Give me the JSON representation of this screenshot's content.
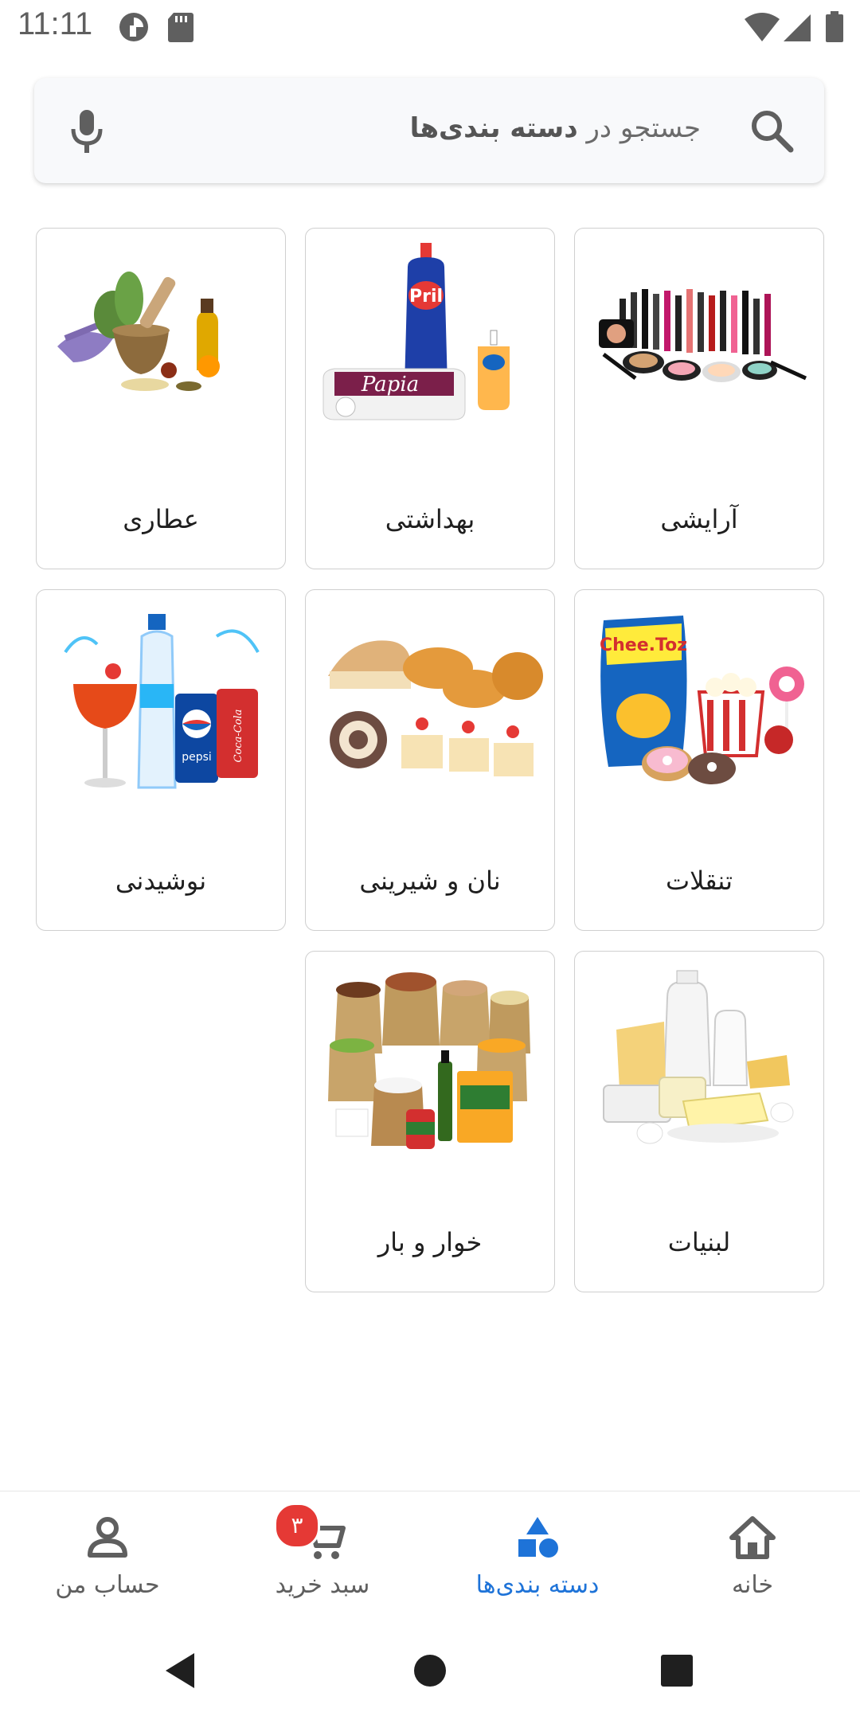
{
  "status_bar": {
    "time": "11:11",
    "icons": [
      "pinwheel-icon",
      "sd-card-icon",
      "wifi-icon",
      "signal-icon",
      "battery-icon"
    ]
  },
  "search": {
    "placeholder_prefix": "جستجو در",
    "placeholder_bold": "دسته بندی‌ها",
    "icons": [
      "search-icon",
      "mic-icon"
    ]
  },
  "categories": [
    {
      "label": "آرایشی",
      "icon": "cosmetics-image"
    },
    {
      "label": "بهداشتی",
      "icon": "hygiene-image"
    },
    {
      "label": "عطاری",
      "icon": "herbs-image"
    },
    {
      "label": "تنقلات",
      "icon": "snacks-image"
    },
    {
      "label": "نان و شیرینی",
      "icon": "bread-pastry-image"
    },
    {
      "label": "نوشیدنی",
      "icon": "drinks-image"
    },
    {
      "label": "لبنیات",
      "icon": "dairy-image"
    },
    {
      "label": "خوار و بار",
      "icon": "groceries-image"
    }
  ],
  "bottom_nav": {
    "home": "خانه",
    "categories": "دسته بندی‌ها",
    "cart": "سبد خرید",
    "cart_badge": "۳",
    "account": "حساب من",
    "active": "categories",
    "active_color": "#1e73d8",
    "badge_color": "#e53935"
  },
  "system_nav": [
    "back-icon",
    "home-circle-icon",
    "recents-icon"
  ]
}
